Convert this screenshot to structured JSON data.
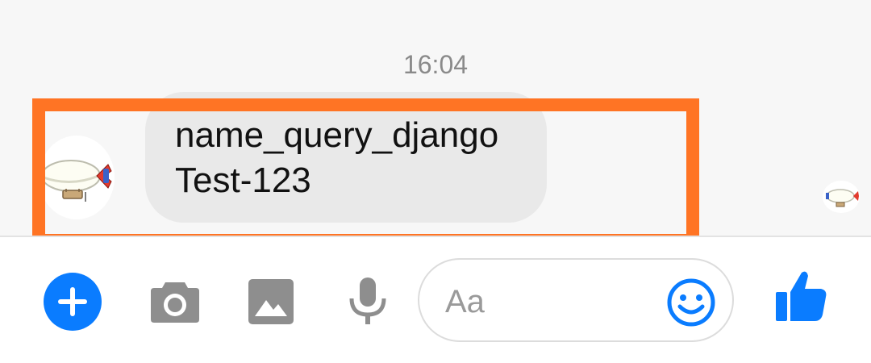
{
  "chat": {
    "timestamp": "16:04",
    "message": {
      "line1": "name_query_django",
      "line2": "Test-123"
    },
    "highlight_color": "#ff7424"
  },
  "composer": {
    "input_placeholder": "Aa",
    "icons": [
      "plus-icon",
      "camera-icon",
      "image-icon",
      "microphone-icon",
      "emoji-icon",
      "thumbs-up-icon"
    ],
    "accent_color": "#0a7cff"
  }
}
